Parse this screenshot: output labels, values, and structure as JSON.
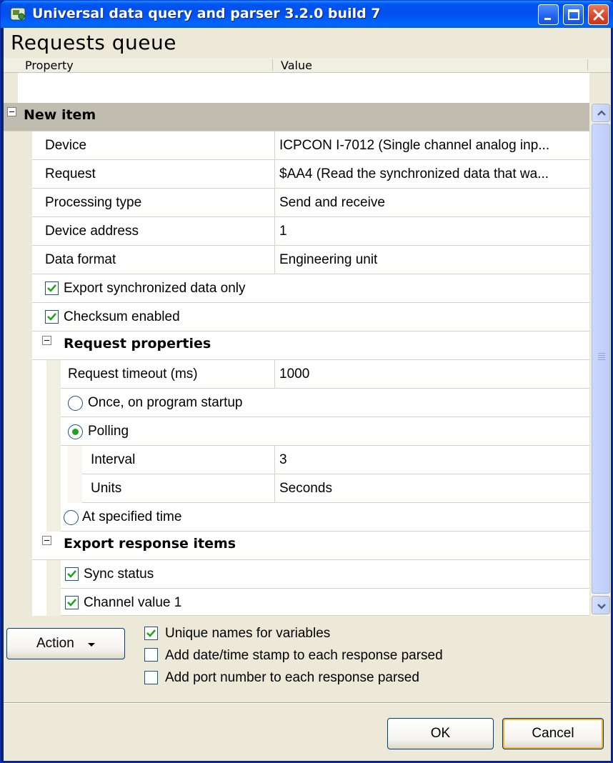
{
  "window": {
    "title": "Universal data query and parser 3.2.0 build 7"
  },
  "heading": "Requests queue",
  "columns": {
    "property": "Property",
    "value": "Value"
  },
  "grid": {
    "new_item": "New item",
    "device_label": "Device",
    "device_value": "ICPCON I-7012 (Single channel analog inp...",
    "request_label": "Request",
    "request_value": "$AA4 (Read the synchronized data that wa...",
    "processing_label": "Processing type",
    "processing_value": "Send and receive",
    "address_label": "Device address",
    "address_value": "1",
    "format_label": "Data format",
    "format_value": "Engineering unit",
    "export_sync_label": "Export synchronized data only",
    "export_sync_checked": true,
    "checksum_label": "Checksum enabled",
    "checksum_checked": true,
    "request_props": "Request properties",
    "timeout_label": "Request timeout (ms)",
    "timeout_value": "1000",
    "once_label": "Once, on program startup",
    "polling_label": "Polling",
    "interval_label": "Interval",
    "interval_value": "3",
    "units_label": "Units",
    "units_value": "Seconds",
    "specified_label": "At specified time",
    "export_items": "Export response items",
    "sync_status_label": "Sync status",
    "channel_label": "Channel value 1"
  },
  "bottom": {
    "action_label": "Action",
    "unique_names_label": "Unique names for variables",
    "unique_names_checked": true,
    "datetime_label": "Add date/time stamp to each response parsed",
    "datetime_checked": false,
    "port_label": "Add port number to each response parsed",
    "port_checked": false,
    "ok_label": "OK",
    "cancel_label": "Cancel"
  },
  "colors": {
    "titlebar": "#0053ee",
    "face": "#ece9d8",
    "category_row": "#c0bdb0",
    "check_mark": "#21a121"
  }
}
